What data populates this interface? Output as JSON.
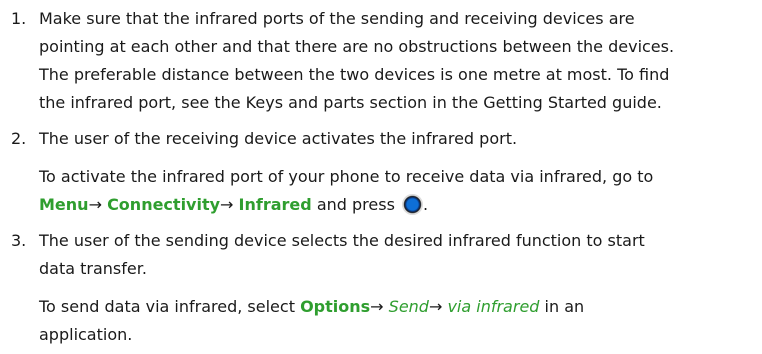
{
  "steps": [
    {
      "number": "1.",
      "lines": [
        "Make sure that the infrared ports of the sending and receiving devices are",
        "pointing at each other and that there are no obstructions between the devices.",
        "The preferable distance between the two devices is one metre at most. To find",
        "the infrared port, see the Keys and parts section in the Getting Started guide."
      ]
    },
    {
      "number": "2.",
      "line": "The user of the receiving device activates the infrared port.",
      "note_line1": "To activate the infrared port of your phone to receive data via infrared, go to",
      "menu": "Menu",
      "arrow": "→",
      "connectivity": "Connectivity",
      "infrared": "Infrared",
      "press_text": "and press",
      "period": ".",
      "key_icon": "navigation-key-icon"
    },
    {
      "number": "3.",
      "lines": [
        "The user of the sending device selects the desired infrared function to start",
        "data transfer."
      ],
      "note_prefix": "To send data via infrared, select",
      "options": "Options",
      "arrow": "→",
      "send": "Send",
      "via_infrared": "via infrared",
      "note_suffix": "in an",
      "note_line2": "application."
    }
  ]
}
